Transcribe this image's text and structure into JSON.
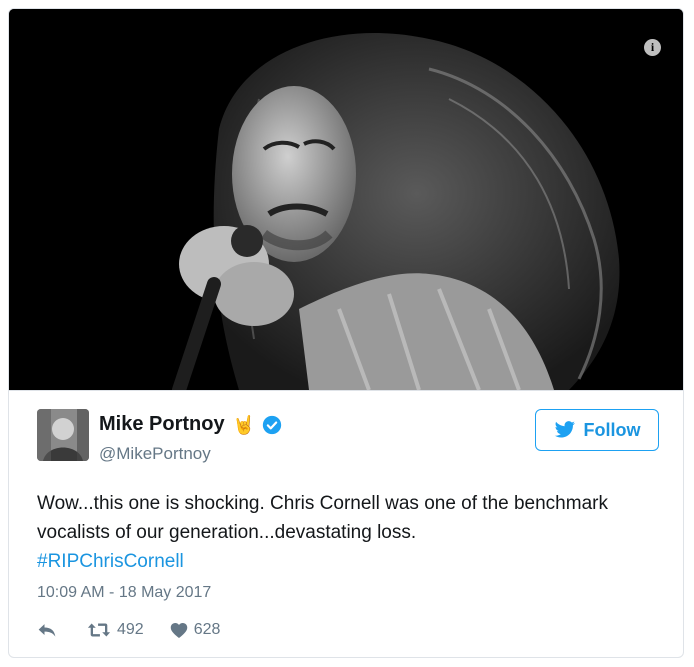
{
  "tweet": {
    "author_name": "Mike Portnoy",
    "author_emoji": "🤘",
    "author_handle": "@MikePortnoy",
    "follow_label": "Follow",
    "text": "Wow...this one is shocking. Chris Cornell was one of the benchmark vocalists of our generation...devastating loss.",
    "hashtag": "#RIPChrisCornell",
    "timestamp": "10:09 AM - 18 May 2017",
    "retweets": "492",
    "likes": "628"
  },
  "media": {
    "info_icon_glyph": "i",
    "alt": "black and white photo of long-haired singer holding microphone"
  },
  "icons": {
    "info": "info-icon",
    "verified": "verified-badge-icon",
    "bird": "twitter-bird-icon",
    "reply": "reply-icon",
    "retweet": "retweet-icon",
    "like": "heart-icon"
  },
  "colors": {
    "accent": "#1da1f2",
    "link": "#1b95e0",
    "text": "#14171a",
    "muted": "#657786",
    "border": "#dfe3e8"
  }
}
